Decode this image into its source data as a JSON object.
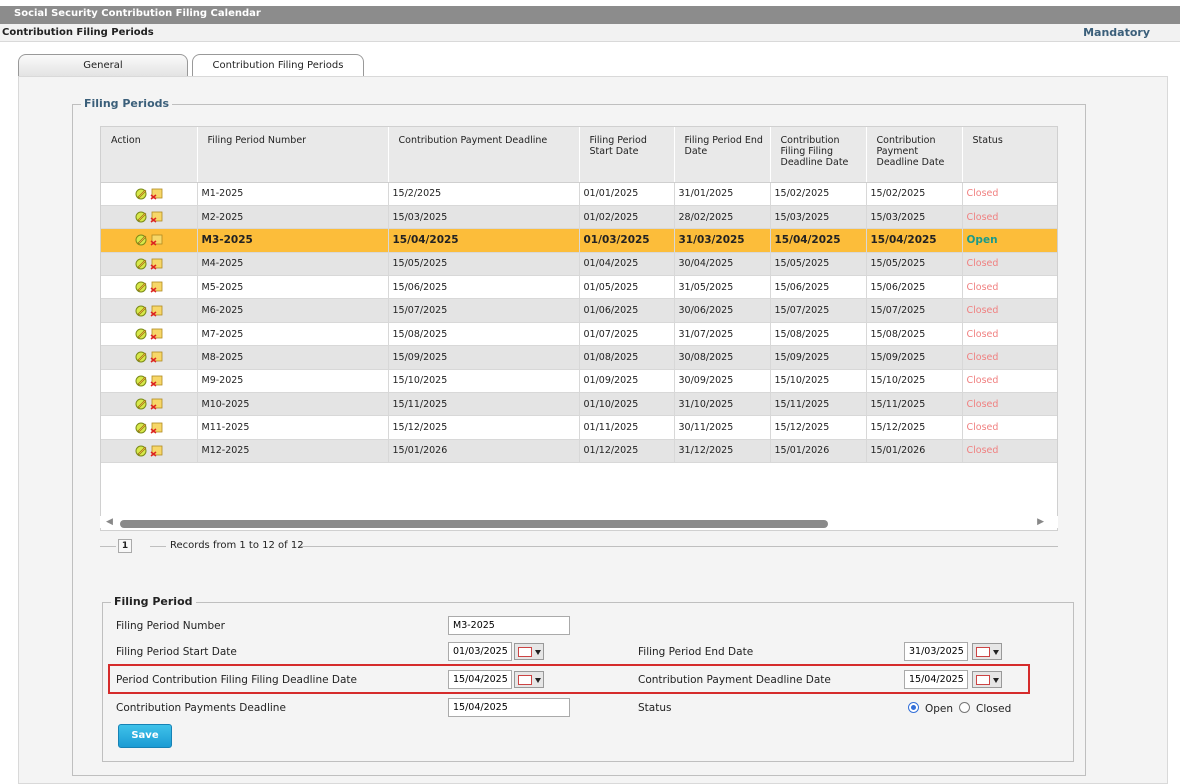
{
  "header": {
    "app_title": "Social Security Contribution Filing Calendar",
    "section_title": "Contribution Filing Periods",
    "mandatory": "Mandatory"
  },
  "tabs": [
    {
      "label": "General",
      "active": false
    },
    {
      "label": "Contribution Filing Periods",
      "active": true
    }
  ],
  "filing_periods": {
    "legend": "Filing Periods",
    "columns": [
      "Action",
      "Filing Period Number",
      "Contribution Payment Deadline",
      "Filing Period Start Date",
      "Filing Period End Date",
      "Contribution Filing Filing Deadline Date",
      "Contribution Payment Deadline Date",
      "Status"
    ],
    "rows": [
      {
        "number": "M1-2025",
        "payment_deadline": "15/2/2025",
        "start": "01/01/2025",
        "end": "31/01/2025",
        "filing_deadline": "15/02/2025",
        "payment_deadline_date": "15/02/2025",
        "status": "Closed"
      },
      {
        "number": "M2-2025",
        "payment_deadline": "15/03/2025",
        "start": "01/02/2025",
        "end": "28/02/2025",
        "filing_deadline": "15/03/2025",
        "payment_deadline_date": "15/03/2025",
        "status": "Closed"
      },
      {
        "number": "M3-2025",
        "payment_deadline": "15/04/2025",
        "start": "01/03/2025",
        "end": "31/03/2025",
        "filing_deadline": "15/04/2025",
        "payment_deadline_date": "15/04/2025",
        "status": "Open"
      },
      {
        "number": "M4-2025",
        "payment_deadline": "15/05/2025",
        "start": "01/04/2025",
        "end": "30/04/2025",
        "filing_deadline": "15/05/2025",
        "payment_deadline_date": "15/05/2025",
        "status": "Closed"
      },
      {
        "number": "M5-2025",
        "payment_deadline": "15/06/2025",
        "start": "01/05/2025",
        "end": "31/05/2025",
        "filing_deadline": "15/06/2025",
        "payment_deadline_date": "15/06/2025",
        "status": "Closed"
      },
      {
        "number": "M6-2025",
        "payment_deadline": "15/07/2025",
        "start": "01/06/2025",
        "end": "30/06/2025",
        "filing_deadline": "15/07/2025",
        "payment_deadline_date": "15/07/2025",
        "status": "Closed"
      },
      {
        "number": "M7-2025",
        "payment_deadline": "15/08/2025",
        "start": "01/07/2025",
        "end": "31/07/2025",
        "filing_deadline": "15/08/2025",
        "payment_deadline_date": "15/08/2025",
        "status": "Closed"
      },
      {
        "number": "M8-2025",
        "payment_deadline": "15/09/2025",
        "start": "01/08/2025",
        "end": "30/08/2025",
        "filing_deadline": "15/09/2025",
        "payment_deadline_date": "15/09/2025",
        "status": "Closed"
      },
      {
        "number": "M9-2025",
        "payment_deadline": "15/10/2025",
        "start": "01/09/2025",
        "end": "30/09/2025",
        "filing_deadline": "15/10/2025",
        "payment_deadline_date": "15/10/2025",
        "status": "Closed"
      },
      {
        "number": "M10-2025",
        "payment_deadline": "15/11/2025",
        "start": "01/10/2025",
        "end": "31/10/2025",
        "filing_deadline": "15/11/2025",
        "payment_deadline_date": "15/11/2025",
        "status": "Closed"
      },
      {
        "number": "M11-2025",
        "payment_deadline": "15/12/2025",
        "start": "01/11/2025",
        "end": "30/11/2025",
        "filing_deadline": "15/12/2025",
        "payment_deadline_date": "15/12/2025",
        "status": "Closed"
      },
      {
        "number": "M12-2025",
        "payment_deadline": "15/01/2026",
        "start": "01/12/2025",
        "end": "31/12/2025",
        "filing_deadline": "15/01/2026",
        "payment_deadline_date": "15/01/2026",
        "status": "Closed"
      }
    ],
    "selected_row": 2,
    "action_icons": [
      "edit-icon",
      "delete-icon"
    ],
    "status_colors": {
      "Open": "#1a9a8a",
      "Closed": "#f08080"
    },
    "selected_color": "#fcbd3a",
    "pager": {
      "current_page": "1",
      "records_text": "Records from 1 to 12 of 12"
    }
  },
  "form": {
    "legend": "Filing Period",
    "filing_period_number": {
      "label": "Filing Period Number",
      "value": "M3-2025"
    },
    "start_date": {
      "label": "Filing Period Start Date",
      "value": "01/03/2025"
    },
    "end_date": {
      "label": "Filing Period End Date",
      "value": "31/03/2025"
    },
    "filing_deadline": {
      "label": "Period Contribution Filing Filing Deadline Date",
      "value": "15/04/2025"
    },
    "payment_deadline_date": {
      "label": "Contribution Payment Deadline Date",
      "value": "15/04/2025"
    },
    "payments_deadline": {
      "label": "Contribution Payments Deadline",
      "value": "15/04/2025"
    },
    "status": {
      "label": "Status",
      "options": [
        "Open",
        "Closed"
      ],
      "selected": "Open"
    },
    "save_label": "Save",
    "highlight_color": "#d52b2b"
  }
}
